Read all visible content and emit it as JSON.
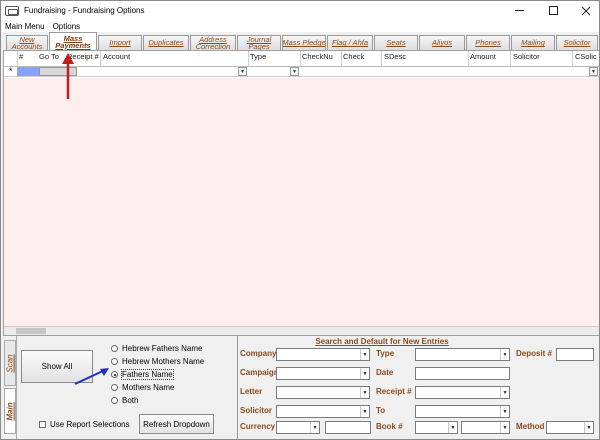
{
  "window": {
    "title": "Fundraising - Fundraising Options"
  },
  "menu": [
    {
      "label": "Main Menu"
    },
    {
      "label": "Options"
    }
  ],
  "tabs": [
    {
      "label": "New Accounts",
      "active": false
    },
    {
      "label": "Mass Payments",
      "active": true
    },
    {
      "label": "Import",
      "active": false
    },
    {
      "label": "Duplicates",
      "active": false
    },
    {
      "label": "Address Correction",
      "active": false
    },
    {
      "label": "Journal Pages",
      "active": false
    },
    {
      "label": "Mass Pledge",
      "active": false
    },
    {
      "label": "Flag / Ahfa",
      "active": false
    },
    {
      "label": "Seats",
      "active": false
    },
    {
      "label": "Aliyos",
      "active": false
    },
    {
      "label": "Phones",
      "active": false
    },
    {
      "label": "Mailing",
      "active": false
    },
    {
      "label": "Solicitor",
      "active": false
    }
  ],
  "grid": {
    "columns": [
      "#",
      "Go To",
      "Receipt #",
      "Account",
      "Type",
      "CheckNu",
      "Check",
      "SDesc",
      "Amount",
      "Solicitor",
      "CSolic"
    ],
    "new_row_marker": "*"
  },
  "side_tabs": [
    "Scan",
    "Main"
  ],
  "left_panel": {
    "show_all_label": "Show All",
    "name_options": [
      "Hebrew Fathers Name",
      "Hebrew Mothers Name",
      "Fathers Name",
      "Mothers Name",
      "Both"
    ],
    "selected_option": "Fathers Name",
    "use_report_label": "Use Report Selections",
    "use_report_checked": false,
    "refresh_label": "Refresh Dropdown"
  },
  "defaults_panel": {
    "title": "Search and Default for New Entries",
    "labels": {
      "company": "Company",
      "campaign": "Campaign",
      "letter": "Letter",
      "solicitor": "Solicitor",
      "currency": "Currency",
      "type": "Type",
      "date": "Date",
      "receipt": "Receipt #",
      "to": "To",
      "book": "Book #",
      "deposit": "Deposit #",
      "method": "Method"
    }
  },
  "colors": {
    "accent_label": "#8a4a1c",
    "grid_body": "#ffeeee",
    "row_selector": "#8aa0ff",
    "annotation_red": "#c41a1a",
    "annotation_blue": "#1f2fbf"
  }
}
